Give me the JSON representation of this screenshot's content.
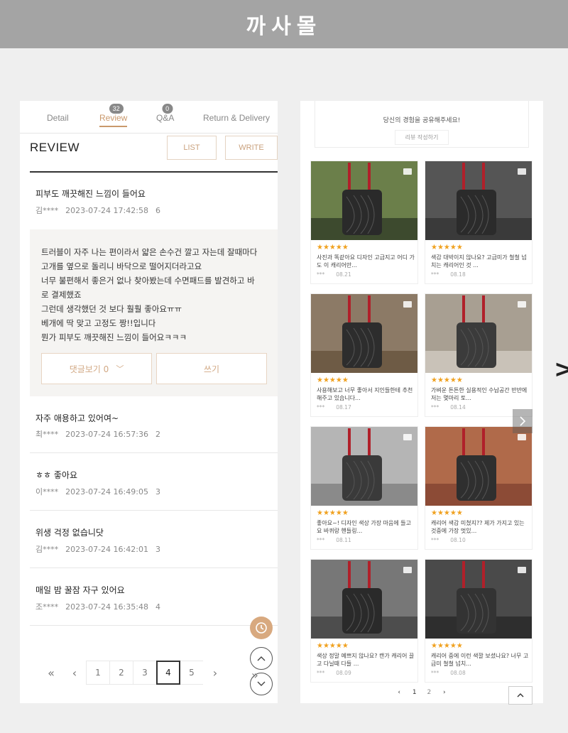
{
  "banner": {
    "title": "까사몰"
  },
  "left": {
    "tabs": [
      {
        "label": "Detail"
      },
      {
        "label": "Review",
        "badge": "32"
      },
      {
        "label": "Q&A",
        "badge": "0"
      },
      {
        "label": "Return & Delivery"
      }
    ],
    "heading": "REVIEW",
    "list_label": "LIST",
    "write_label": "WRITE",
    "open_review": {
      "title": "피부도 깨끗해진 느낌이 들어요",
      "author": "김****",
      "date": "2023-07-24 17:42:58",
      "views": "6",
      "body": [
        "트러블이 자주 나는 편이라서 얇은 손수건 깔고 자는데 잘때마다",
        "고개를 옆으로 돌리니 바닥으로 떨어지더라고요",
        "너무 불편해서 좋은거 없나 찾아봤는데 수면패드를 발견하고 바",
        "로 결제했죠",
        "그런데 생각했던 것 보다 훨훨 좋아요ㅠㅠ",
        "베개에 딱 맞고 고정도 짱!!입니다",
        "뭔가 피부도 깨끗해진 느낌이 들어요ㅋㅋㅋ"
      ],
      "comments_label": "댓글보기 0",
      "write_comment_label": "쓰기"
    },
    "reviews": [
      {
        "title": "자주 애용하고 있어여~",
        "author": "최****",
        "date": "2023-07-24 16:57:36",
        "views": "2"
      },
      {
        "title": "ㅎㅎ 좋아요",
        "author": "이****",
        "date": "2023-07-24 16:49:05",
        "views": "3"
      },
      {
        "title": "위생 걱정 없습니닷",
        "author": "김****",
        "date": "2023-07-24 16:42:01",
        "views": "3"
      },
      {
        "title": "매일 밤 꿀잠 자구 있어요",
        "author": "조****",
        "date": "2023-07-24 16:35:48",
        "views": "4"
      }
    ],
    "pager": {
      "first": "«",
      "prev": "‹",
      "pages": [
        "1",
        "2",
        "3",
        "4",
        "5"
      ],
      "current": "4",
      "next": "›",
      "last": "»"
    }
  },
  "right": {
    "share_text": "당신의 경험을 공유해주세요!",
    "share_button": "리뷰 작성하기",
    "cards": [
      {
        "stars": "★★★★★",
        "text": "사진과 똑같아요 디자인 고급지고 어디 가도 이 캐리어만...",
        "user": "***",
        "date": "08.21"
      },
      {
        "stars": "★★★★★",
        "text": "색감 대박이지 않나요? 고급미가 철철 넘치는 캐리어인 것 ...",
        "user": "***",
        "date": "08.18"
      },
      {
        "stars": "★★★★★",
        "text": "사용해보고 너무 좋아서 지인들한테 추천해주고 있습니다...",
        "user": "***",
        "date": "08.17"
      },
      {
        "stars": "★★★★★",
        "text": "가벼운 튼튼한 실용적인 수납공간 반반에 저는 몇마리 토...",
        "user": "***",
        "date": "08.14"
      },
      {
        "stars": "★★★★★",
        "text": "좋아요~! 디자인 색상 가장 마음에 들고요 바퀴랑 핸들링...",
        "user": "***",
        "date": "08.11"
      },
      {
        "stars": "★★★★★",
        "text": "캐리어 색감 미쳤지?? 제가 가지고 있는 것중에 가장 멋있...",
        "user": "***",
        "date": "08.10"
      },
      {
        "stars": "★★★★★",
        "text": "색상 정말 예쁘지 않나요? 캔가 캐리어 끌고 다닐때 다들 ...",
        "user": "***",
        "date": "08.09"
      },
      {
        "stars": "★★★★★",
        "text": "캐리어 중에 이런 색깔 보셨나요? 너무 고급미 철철 넘치...",
        "user": "***",
        "date": "08.08"
      }
    ],
    "pager": {
      "prev": "‹",
      "pages": [
        "1",
        "2"
      ],
      "next": "›"
    },
    "top_button": "^"
  }
}
